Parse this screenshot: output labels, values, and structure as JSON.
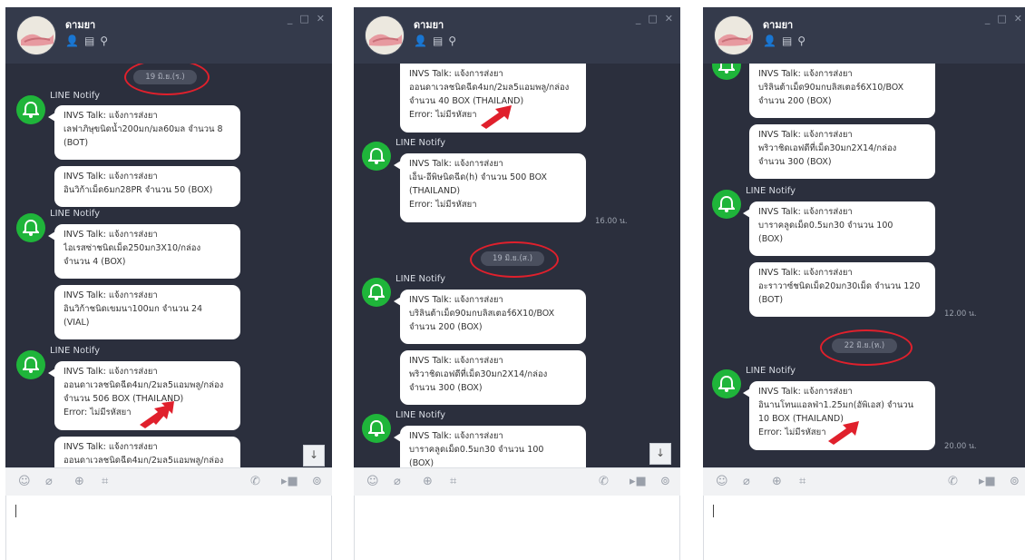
{
  "colors": {
    "window_bg": "#2b2f3d",
    "titlebar": "#343a4b",
    "bell_green": "#1fb53a",
    "highlight_red": "#e0202c",
    "bubble": "#ffffff"
  },
  "chat": {
    "title": "ดามยา",
    "icons": [
      "person-icon",
      "notebook-icon",
      "search-icon"
    ],
    "controls": [
      "minimize-icon",
      "maximize-icon",
      "close-icon"
    ]
  },
  "sender": "LINE Notify",
  "toolbar_icons": [
    "emoji-icon",
    "attach-icon",
    "keep-icon",
    "screenshot-icon",
    "call-icon",
    "video-icon",
    "settings-icon"
  ],
  "windows": [
    {
      "date": "19 มิ.ย.(ร.)",
      "bubbles": [
        [
          "INVS Talk: แจ้งการส่งยา",
          "เลฟาภิษุขนิดน้ำ200มก/มล60มล จำนวน 8",
          "(BOT)"
        ],
        [
          "INVS Talk: แจ้งการส่งยา",
          "อินวิก้าเม็ด6มก28PR จำนวน 50 (BOX)"
        ],
        [
          "INVS Talk: แจ้งการส่งยา",
          "ไอเรสซ่าชนิดเม็ด250มก3X10/กล่อง",
          "จำนวน 4 (BOX)"
        ],
        [
          "INVS Talk: แจ้งการส่งยา",
          "อินวิก้าชนิดเขมนา100มก จำนวน 24",
          "(VIAL)"
        ],
        [
          "INVS Talk: แจ้งการส่งยา",
          "ออนดาเวลชนิดฉีด4มก/2มล5แอมพลู/กล่อง",
          "จำนวน 506 BOX (THAILAND)",
          "Error: ไม่มีรหัสยา"
        ],
        [
          "INVS Talk: แจ้งการส่งยา",
          "ออนดาเวลชนิดฉีด4มก/2มล5แอมพลู/กล่อง"
        ]
      ]
    },
    {
      "date": "19 มิ.ย.(ส.)",
      "time": "16.00 น.",
      "bubbles": [
        [
          "INVS Talk: แจ้งการส่งยา",
          "ออนดาเวลชนิดฉีด4มก/2มล5แอมพลู/กล่อง",
          "จำนวน 40 BOX (THAILAND)",
          "Error: ไม่มีรหัสยา"
        ],
        [
          "INVS Talk: แจ้งการส่งยา",
          "เอ็น-อีพิษนิดฉีด(h) จำนวน 500 BOX",
          "(THAILAND)",
          "Error: ไม่มีรหัสยา"
        ],
        [
          "INVS Talk: แจ้งการส่งยา",
          "บริลินต้าเม็ด90มกบลิสเตอร์6X10/BOX",
          "จำนวน 200 (BOX)"
        ],
        [
          "INVS Talk: แจ้งการส่งยา",
          "พริวาชิดเอฟดีที่เม็ด30มก2X14/กล่อง",
          "จำนวน 300 (BOX)"
        ],
        [
          "INVS Talk: แจ้งการส่งยา",
          "บาราคลูดเม็ด0.5มก30 จำนวน 100",
          "(BOX)"
        ]
      ]
    },
    {
      "date": "22 มิ.ย.(ห.)",
      "time1": "12.00 น.",
      "time2": "20.00 น.",
      "bubbles": [
        [
          "INVS Talk: แจ้งการส่งยา",
          "บริลินต้าเม็ด90มกบลิสเตอร์6X10/BOX",
          "จำนวน 200 (BOX)"
        ],
        [
          "INVS Talk: แจ้งการส่งยา",
          "พริวาชิดเอฟดีที่เม็ด30มก2X14/กล่อง",
          "จำนวน 300 (BOX)"
        ],
        [
          "INVS Talk: แจ้งการส่งยา",
          "บาราคลูดเม็ด0.5มก30 จำนวน 100",
          "(BOX)"
        ],
        [
          "INVS Talk: แจ้งการส่งยา",
          "อะราวาซ์ชนิดเม็ด20มก30เม็ด จำนวน 120",
          "(BOT)"
        ],
        [
          "INVS Talk: แจ้งการส่งยา",
          "อินานโทนแอลฟ่า1.25มก(อัพิเอส) จำนวน",
          "10 BOX (THAILAND)",
          "Error: ไม่มีรหัสยา"
        ]
      ]
    }
  ]
}
